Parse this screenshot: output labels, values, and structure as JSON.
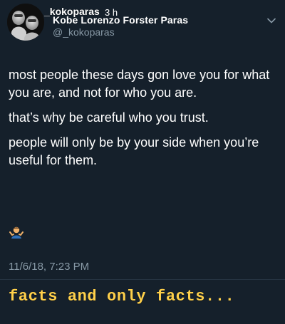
{
  "tweet": {
    "display_name": "Kobe Lorenzo Forster Paras",
    "handle": "@_kokoparas",
    "overlay_handle": "_kokoparas",
    "overlay_time": "3 h",
    "body_paragraphs": [
      "most people these days gon love you for what you are, and not for who you are.",
      "that’s why be careful who you trust.",
      "people will only be by your side when you’re useful for them."
    ],
    "timestamp": "11/6/18, 7:23 PM",
    "emoji_icon": "person-shrugging-icon",
    "menu_icon": "chevron-down-icon",
    "avatar_icon": "profile-avatar-icon"
  },
  "caption": {
    "text": "facts and only facts..."
  },
  "colors": {
    "background": "#15202b",
    "primary_text": "#ffffff",
    "secondary_text": "#8899a6",
    "caption_text": "#ffd04a"
  }
}
